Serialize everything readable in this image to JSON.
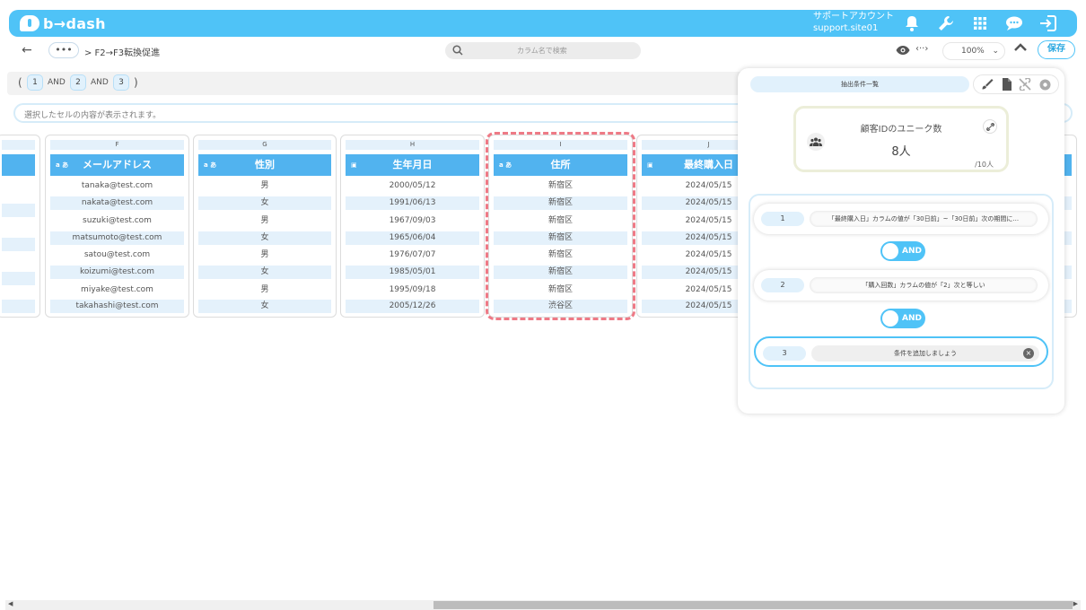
{
  "header": {
    "logo_text": "b→dash",
    "account_line1": "サポートアカウント",
    "account_line2": "support.site01",
    "icons": [
      "bell-icon",
      "wrench-icon",
      "grid-icon",
      "chat-icon",
      "logout-icon"
    ]
  },
  "subbar": {
    "back": "←",
    "dots": "•••",
    "breadcrumb": "> F2→F3転換促進",
    "search_placeholder": "カラム名で検索",
    "code_toggle": "‹··›",
    "zoom": "100%",
    "save": "保存"
  },
  "condition_line": {
    "open": "(",
    "close": ")",
    "items": [
      "1",
      "2",
      "3"
    ],
    "operators": [
      "AND",
      "AND"
    ]
  },
  "cell_info_placeholder": "選択したセルの内容が表示されます。",
  "grid": {
    "columns": [
      {
        "letter": "F",
        "name": "メールアドレス",
        "type": "テキスト",
        "values": [
          "tanaka@test.com",
          "nakata@test.com",
          "suzuki@test.com",
          "matsumoto@test.com",
          "satou@test.com",
          "koizumi@test.com",
          "miyake@test.com",
          "takahashi@test.com"
        ]
      },
      {
        "letter": "G",
        "name": "性別",
        "type": "テキスト",
        "values": [
          "男",
          "女",
          "男",
          "女",
          "男",
          "女",
          "男",
          "女"
        ]
      },
      {
        "letter": "H",
        "name": "生年月日",
        "type": "日付",
        "values": [
          "2000/05/12",
          "1991/06/13",
          "1967/09/03",
          "1965/06/04",
          "1976/07/07",
          "1985/05/01",
          "1995/09/18",
          "2005/12/26"
        ]
      },
      {
        "letter": "I",
        "name": "住所",
        "type": "テキスト",
        "values": [
          "新宿区",
          "新宿区",
          "新宿区",
          "新宿区",
          "新宿区",
          "新宿区",
          "新宿区",
          "渋谷区"
        ]
      },
      {
        "letter": "J",
        "name": "最終購入日",
        "type": "日付",
        "values": [
          "2024/05/15",
          "2024/05/15",
          "2024/05/15",
          "2024/05/15",
          "2024/05/15",
          "2024/05/15",
          "2024/05/15",
          "2024/05/15"
        ]
      }
    ]
  },
  "panel": {
    "tab": "抽出条件一覧",
    "unique_title": "顧客IDのユニーク数",
    "unique_value": "8人",
    "unique_total": "/10人",
    "conditions": [
      {
        "num": "1",
        "text": "「最終購入日」カラムの値が「30日前」~「30日前」次の期間に..."
      },
      {
        "num": "2",
        "text": "「購入回数」カラムの値が「2」次と等しい"
      },
      {
        "num": "3",
        "text": "条件を追加しましょう"
      }
    ],
    "operators": [
      "AND",
      "AND"
    ]
  },
  "colors": {
    "primary": "#4fc3f7",
    "header_cell": "#51b3ef",
    "row_shade": "#e4f1fb",
    "highlight": "#ee7a86"
  }
}
